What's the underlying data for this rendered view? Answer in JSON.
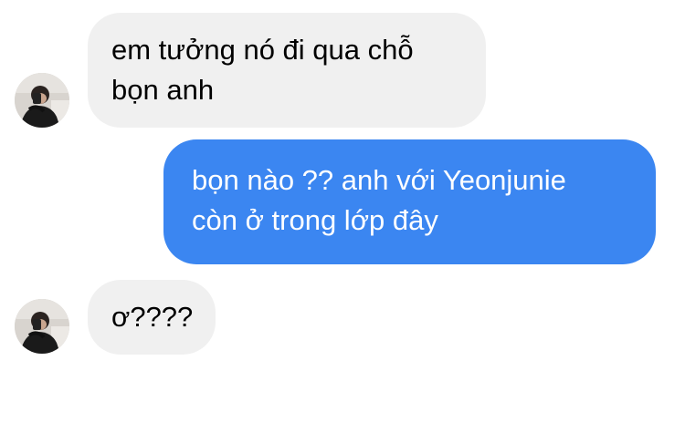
{
  "conversation": {
    "messages": [
      {
        "direction": "incoming",
        "text": "em tưởng nó đi qua chỗ\nbọn anh",
        "avatar": "contact-avatar"
      },
      {
        "direction": "outgoing",
        "text": "bọn nào ?? anh với Yeonjunie\ncòn ở trong lớp đây"
      },
      {
        "direction": "incoming",
        "text": "ơ????",
        "avatar": "contact-avatar"
      }
    ]
  },
  "colors": {
    "incoming_bubble": "#f0f0f0",
    "outgoing_bubble": "#3b86f1",
    "incoming_text": "#000000",
    "outgoing_text": "#ffffff",
    "background": "#ffffff"
  }
}
